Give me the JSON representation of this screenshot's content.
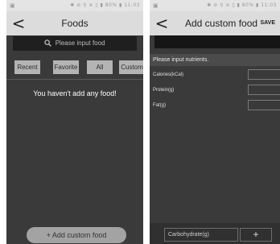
{
  "left": {
    "status": {
      "left": "▣",
      "right": "✱ ⊘ ⚲ ≋ ▯ ▮ 80% ▮ 11:03"
    },
    "appbar": {
      "back": "<",
      "title": "Foods"
    },
    "search": {
      "placeholder": "Please input food"
    },
    "tabs": [
      "Recent",
      "Favorite",
      "All",
      "Custom"
    ],
    "empty_message": "You haven't add any food!",
    "add_button": "+ Add custom food"
  },
  "right": {
    "status": {
      "left": "▣",
      "right": "✱ ⊘ ⚲ ≋ ▯ ▮ 80% ▮ 11:03"
    },
    "appbar": {
      "back": "<",
      "title": "Add custom food",
      "save": "SAVE"
    },
    "hint": "Please input nutrients.",
    "nutrients": [
      "Calories(kCal)",
      "Protein(g)",
      "Fat(g)"
    ],
    "bottom": {
      "field": "Carbohydrate(g)",
      "plus": "+"
    }
  },
  "colors": {
    "dark_bg": "#3a3a3a",
    "appbar_bg": "#dcdcdc",
    "tab_bg": "#b4b4b4",
    "button_bg": "#a3a3a3"
  }
}
